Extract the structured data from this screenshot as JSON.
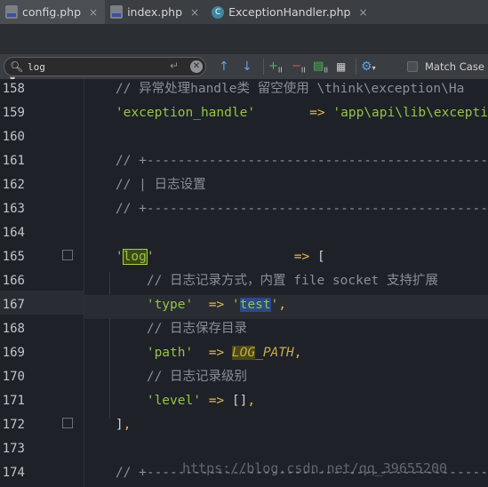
{
  "tabs": [
    {
      "label": "config.php",
      "icon": "php-file-icon",
      "active": true
    },
    {
      "label": "index.php",
      "icon": "php-file-icon",
      "active": false
    },
    {
      "label": "ExceptionHandler.php",
      "icon": "class-file-icon",
      "active": false
    }
  ],
  "tab_close_glyph": "×",
  "search": {
    "value": "log",
    "match_case_label": "Match Case",
    "class_icon_letter": "C"
  },
  "watermark": "https://blog.csdn.net/qq_39655200",
  "lines": [
    {
      "n": "158",
      "segs": [
        [
          "c-comment",
          "    // 异常处理handle类 留空使用 \\think\\exception\\Ha"
        ]
      ]
    },
    {
      "n": "159",
      "segs": [
        [
          "c-str",
          "    'exception_handle'"
        ],
        [
          "c-punct",
          "       "
        ],
        [
          "c-op",
          "=>"
        ],
        [
          "c-punct",
          " "
        ],
        [
          "c-str",
          "'app\\api\\lib\\excepti"
        ]
      ]
    },
    {
      "n": "160",
      "segs": []
    },
    {
      "n": "161",
      "segs": [
        [
          "c-comment",
          "    // +---------------------------------------------"
        ]
      ]
    },
    {
      "n": "162",
      "segs": [
        [
          "c-comment",
          "    // | 日志设置"
        ]
      ]
    },
    {
      "n": "163",
      "segs": [
        [
          "c-comment",
          "    // +---------------------------------------------"
        ]
      ]
    },
    {
      "n": "164",
      "segs": []
    },
    {
      "n": "165",
      "segs": [
        [
          "c-str",
          "    '"
        ],
        [
          "c-str hl-box",
          "log"
        ],
        [
          "c-str",
          "'"
        ],
        [
          "c-punct",
          "                  "
        ],
        [
          "c-op",
          "=>"
        ],
        [
          "c-punct",
          " ["
        ]
      ]
    },
    {
      "n": "166",
      "segs": [
        [
          "c-comment",
          "        // 日志记录方式，内置 file socket 支持扩展"
        ]
      ]
    },
    {
      "n": "167",
      "segs": [
        [
          "c-str",
          "        'type'"
        ],
        [
          "c-punct",
          "  "
        ],
        [
          "c-op",
          "=>"
        ],
        [
          "c-punct",
          " "
        ],
        [
          "c-str",
          "'"
        ],
        [
          "c-str hl-blue",
          "test"
        ],
        [
          "c-str",
          "'"
        ],
        [
          "c-op",
          ","
        ]
      ]
    },
    {
      "n": "168",
      "segs": [
        [
          "c-comment",
          "        // 日志保存目录"
        ]
      ]
    },
    {
      "n": "169",
      "segs": [
        [
          "c-str",
          "        'path'"
        ],
        [
          "c-punct",
          "  "
        ],
        [
          "c-op",
          "=>"
        ],
        [
          "c-punct",
          " "
        ],
        [
          "c-const hl-olive",
          "LOG"
        ],
        [
          "c-const",
          "_PATH"
        ],
        [
          "c-op",
          ","
        ]
      ]
    },
    {
      "n": "170",
      "segs": [
        [
          "c-comment",
          "        // 日志记录级别"
        ]
      ]
    },
    {
      "n": "171",
      "segs": [
        [
          "c-str",
          "        'level'"
        ],
        [
          "c-punct",
          " "
        ],
        [
          "c-op",
          "=>"
        ],
        [
          "c-punct",
          " []"
        ],
        [
          "c-op",
          ","
        ]
      ]
    },
    {
      "n": "172",
      "segs": [
        [
          "c-punct",
          "    ]"
        ],
        [
          "c-op",
          ","
        ]
      ]
    },
    {
      "n": "173",
      "segs": []
    },
    {
      "n": "174",
      "segs": [
        [
          "c-comment",
          "    // +---------------------------------------------"
        ]
      ]
    }
  ]
}
